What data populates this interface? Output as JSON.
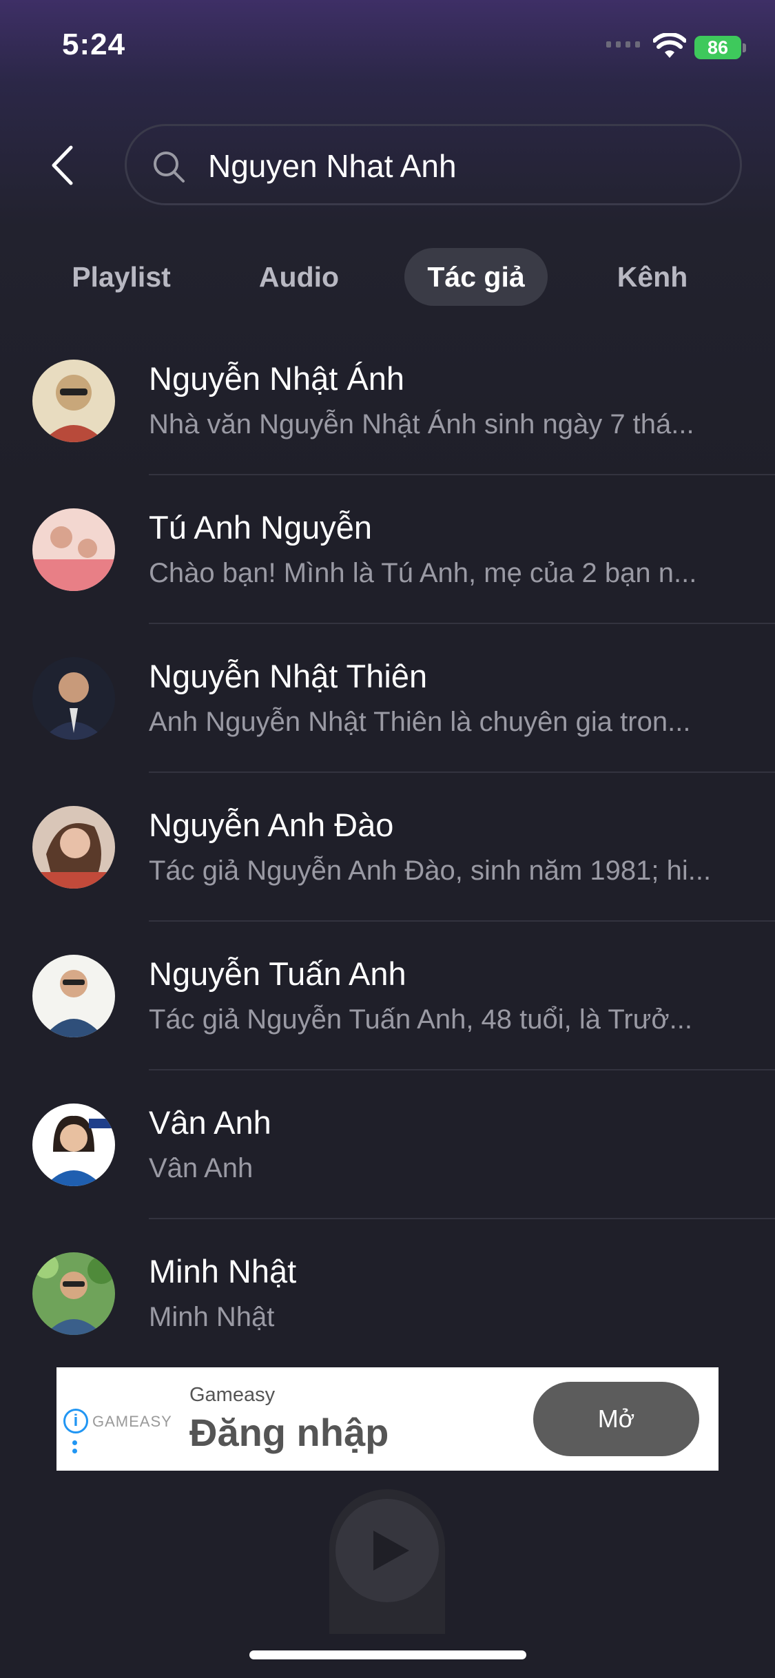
{
  "status_bar": {
    "time": "5:24",
    "battery": "86"
  },
  "search": {
    "value": "Nguyen Nhat Anh"
  },
  "tabs": [
    {
      "label": "Playlist",
      "active": false
    },
    {
      "label": "Audio",
      "active": false
    },
    {
      "label": "Tác giả",
      "active": true
    },
    {
      "label": "Kênh",
      "active": false
    }
  ],
  "authors": [
    {
      "name": "Nguyễn Nhật Ánh",
      "description": "Nhà văn Nguyễn Nhật Ánh sinh ngày 7 thá...",
      "avatar_color": "#c8a77a"
    },
    {
      "name": "Tú Anh Nguyễn",
      "description": "Chào bạn! Mình là Tú Anh, mẹ của 2 bạn n...",
      "avatar_color": "#e89a9a"
    },
    {
      "name": "Nguyễn Nhật Thiên",
      "description": "Anh Nguyễn Nhật Thiên là chuyên gia tron...",
      "avatar_color": "#3a3f55"
    },
    {
      "name": "Nguyễn Anh Đào",
      "description": "Tác giả Nguyễn Anh Đào, sinh năm 1981; hi...",
      "avatar_color": "#a07a66"
    },
    {
      "name": "Nguyễn Tuấn Anh",
      "description": "Tác giả Nguyễn Tuấn Anh, 48 tuổi, là Trưở...",
      "avatar_color": "#5c7aa8"
    },
    {
      "name": "Vân Anh",
      "description": "Vân Anh",
      "avatar_color": "#d9dde6"
    },
    {
      "name": "Minh Nhật",
      "description": "Minh Nhật",
      "avatar_color": "#5d8f4a"
    }
  ],
  "ad": {
    "logo": "GAMEASY",
    "advertiser": "Gameasy",
    "headline": "Đăng nhập",
    "cta": "Mở"
  }
}
